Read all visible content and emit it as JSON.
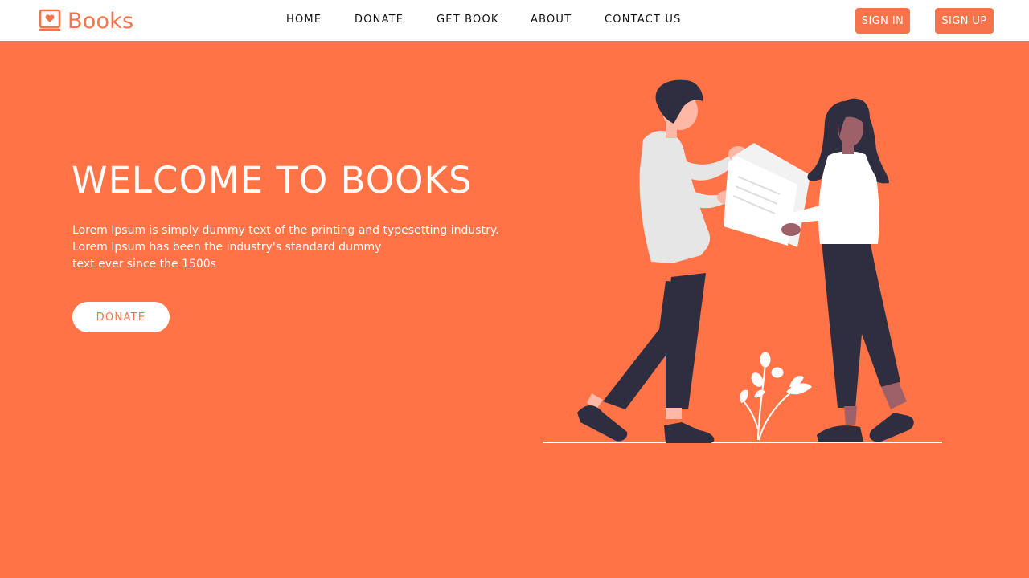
{
  "brand": {
    "name": "Books",
    "color": "#f7734a"
  },
  "nav": {
    "items": [
      {
        "label": "HOME"
      },
      {
        "label": "DONATE"
      },
      {
        "label": "GET BOOK"
      },
      {
        "label": "ABOUT"
      },
      {
        "label": "CONTACT US"
      }
    ]
  },
  "auth": {
    "sign_in": "SIGN IN",
    "sign_up": "SIGN UP"
  },
  "hero": {
    "title": "WELCOME TO BOOKS",
    "lines": [
      "Lorem Ipsum is simply dummy text of the printing and typesetting industry.",
      "Lorem Ipsum has been the industry's standard dummy",
      "text ever since the 1500s"
    ],
    "cta": "DONATE",
    "background": "#ff7347"
  },
  "icons": {
    "logo": "book-heart-icon"
  }
}
